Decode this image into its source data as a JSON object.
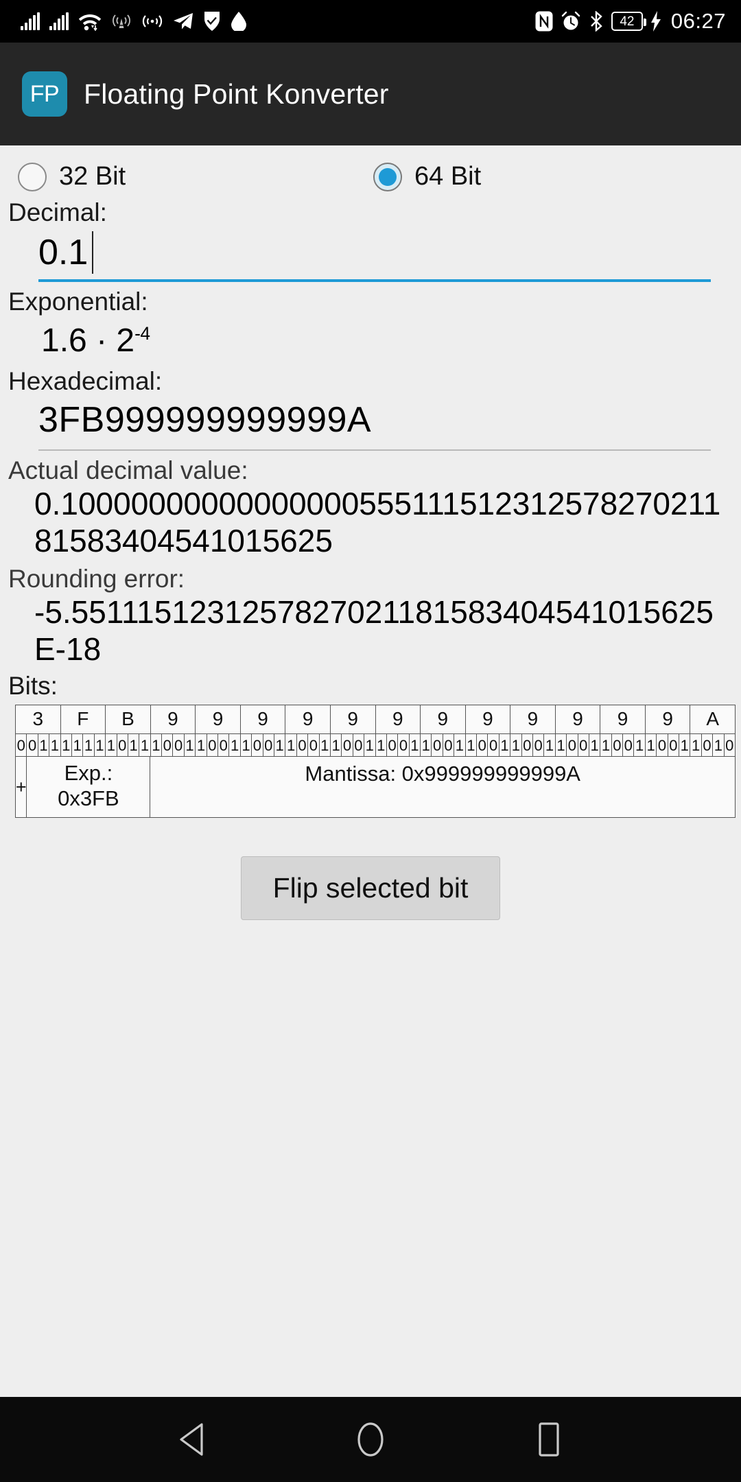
{
  "status_bar": {
    "icons_left": [
      "signal-bars-icon",
      "signal-bars-icon",
      "wifi-icon",
      "cell-tower-icon",
      "broadcast-icon",
      "telegram-icon",
      "checkmark-shield-icon",
      "drop-icon"
    ],
    "icons_right": [
      "nfc-icon",
      "alarm-clock-icon",
      "bluetooth-icon",
      "battery-icon",
      "charging-bolt-icon"
    ],
    "battery_level": "42",
    "time": "06:27"
  },
  "app_bar": {
    "icon_text": "FP",
    "icon_color": "#1e8cad",
    "title": "Floating Point Konverter"
  },
  "precision": {
    "options": [
      {
        "label": "32 Bit",
        "selected": false
      },
      {
        "label": "64 Bit",
        "selected": true
      }
    ],
    "accent_color": "#1e9ad6"
  },
  "decimal": {
    "label": "Decimal:",
    "value": "0.1"
  },
  "exponential": {
    "label": "Exponential:",
    "mantissa": "1.6 · 2",
    "exponent": "-4"
  },
  "hexadecimal": {
    "label": "Hexadecimal:",
    "value": "3FB999999999999A"
  },
  "actual_decimal": {
    "label": "Actual decimal value:",
    "value": "0.1000000000000000055511151231257827021181583404541015625"
  },
  "rounding_error": {
    "label": "Rounding error:",
    "value": "-5.5511151231257827021181583404541015625E-18"
  },
  "bits": {
    "label": "Bits:",
    "nibbles": [
      "3",
      "F",
      "B",
      "9",
      "9",
      "9",
      "9",
      "9",
      "9",
      "9",
      "9",
      "9",
      "9",
      "9",
      "9",
      "A"
    ],
    "binary": "0011111110111001100110011001100110011001100110011001100110011010",
    "sign_label": "+",
    "exponent_label": "Exp.:",
    "exponent_value": "0x3FB",
    "mantissa_label": "Mantissa: 0x999999999999A"
  },
  "flip_button": {
    "label": "Flip selected bit"
  },
  "nav_bar": {
    "back": "back-triangle-icon",
    "home": "home-circle-icon",
    "recents": "recents-square-icon"
  }
}
